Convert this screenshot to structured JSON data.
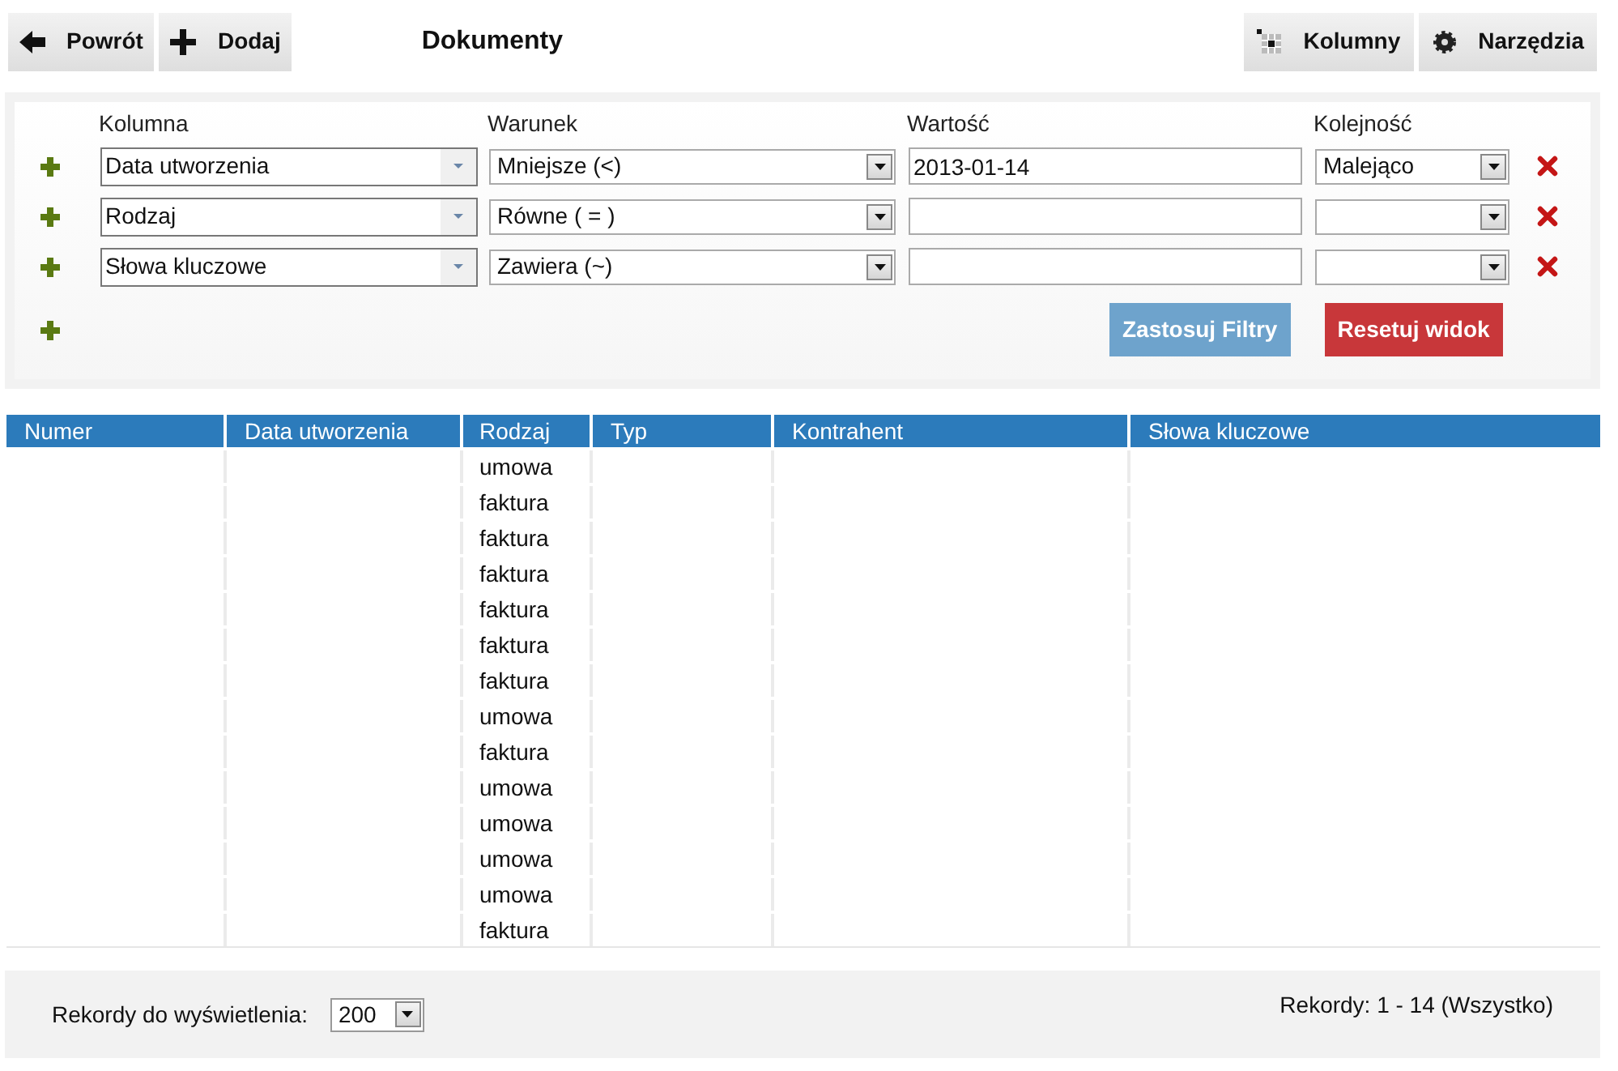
{
  "toolbar": {
    "left_buttons": [
      {
        "label": "Powrót",
        "kind": "back"
      },
      {
        "label": "Dodaj",
        "kind": "add"
      }
    ],
    "title": "Dokumenty",
    "right_buttons": [
      {
        "label": "Kolumny",
        "kind": "columns"
      },
      {
        "label": "Narzędzia",
        "kind": "tools"
      }
    ]
  },
  "filters": {
    "headers": [
      "Kolumna",
      "Warunek",
      "Wartość",
      "Kolejność"
    ],
    "rows": [
      {
        "column": "Data utworzenia",
        "condition": "Mniejsze (<)",
        "value": "2013-01-14",
        "order": "Malejąco"
      },
      {
        "column": "Rodzaj",
        "condition": "Równe ( = )",
        "value": "",
        "order": ""
      },
      {
        "column": "Słowa kluczowe",
        "condition": "Zawiera (~)",
        "value": "",
        "order": ""
      }
    ],
    "apply_button": "Zastosuj Filtry",
    "reset_button": "Resetuj widok"
  },
  "table": {
    "columns": [
      "Numer",
      "Data utworzenia",
      "Rodzaj",
      "Typ",
      "Kontrahent",
      "Słowa kluczowe"
    ],
    "rows": [
      [
        "",
        "",
        "umowa",
        "",
        "",
        ""
      ],
      [
        "",
        "",
        "faktura",
        "",
        "",
        ""
      ],
      [
        "",
        "",
        "faktura",
        "",
        "",
        ""
      ],
      [
        "",
        "",
        "faktura",
        "",
        "",
        ""
      ],
      [
        "",
        "",
        "faktura",
        "",
        "",
        ""
      ],
      [
        "",
        "",
        "faktura",
        "",
        "",
        ""
      ],
      [
        "",
        "",
        "faktura",
        "",
        "",
        ""
      ],
      [
        "",
        "",
        "umowa",
        "",
        "",
        ""
      ],
      [
        "",
        "",
        "faktura",
        "",
        "",
        ""
      ],
      [
        "",
        "",
        "umowa",
        "",
        "",
        ""
      ],
      [
        "",
        "",
        "umowa",
        "",
        "",
        ""
      ],
      [
        "",
        "",
        "umowa",
        "",
        "",
        ""
      ],
      [
        "",
        "",
        "umowa",
        "",
        "",
        ""
      ],
      [
        "",
        "",
        "faktura",
        "",
        "",
        ""
      ]
    ]
  },
  "footer": {
    "page_size_label": "Rekordy do wyświetlenia:",
    "page_size": "200",
    "records": "Rekordy: 1 - 14 (Wszystko)"
  }
}
